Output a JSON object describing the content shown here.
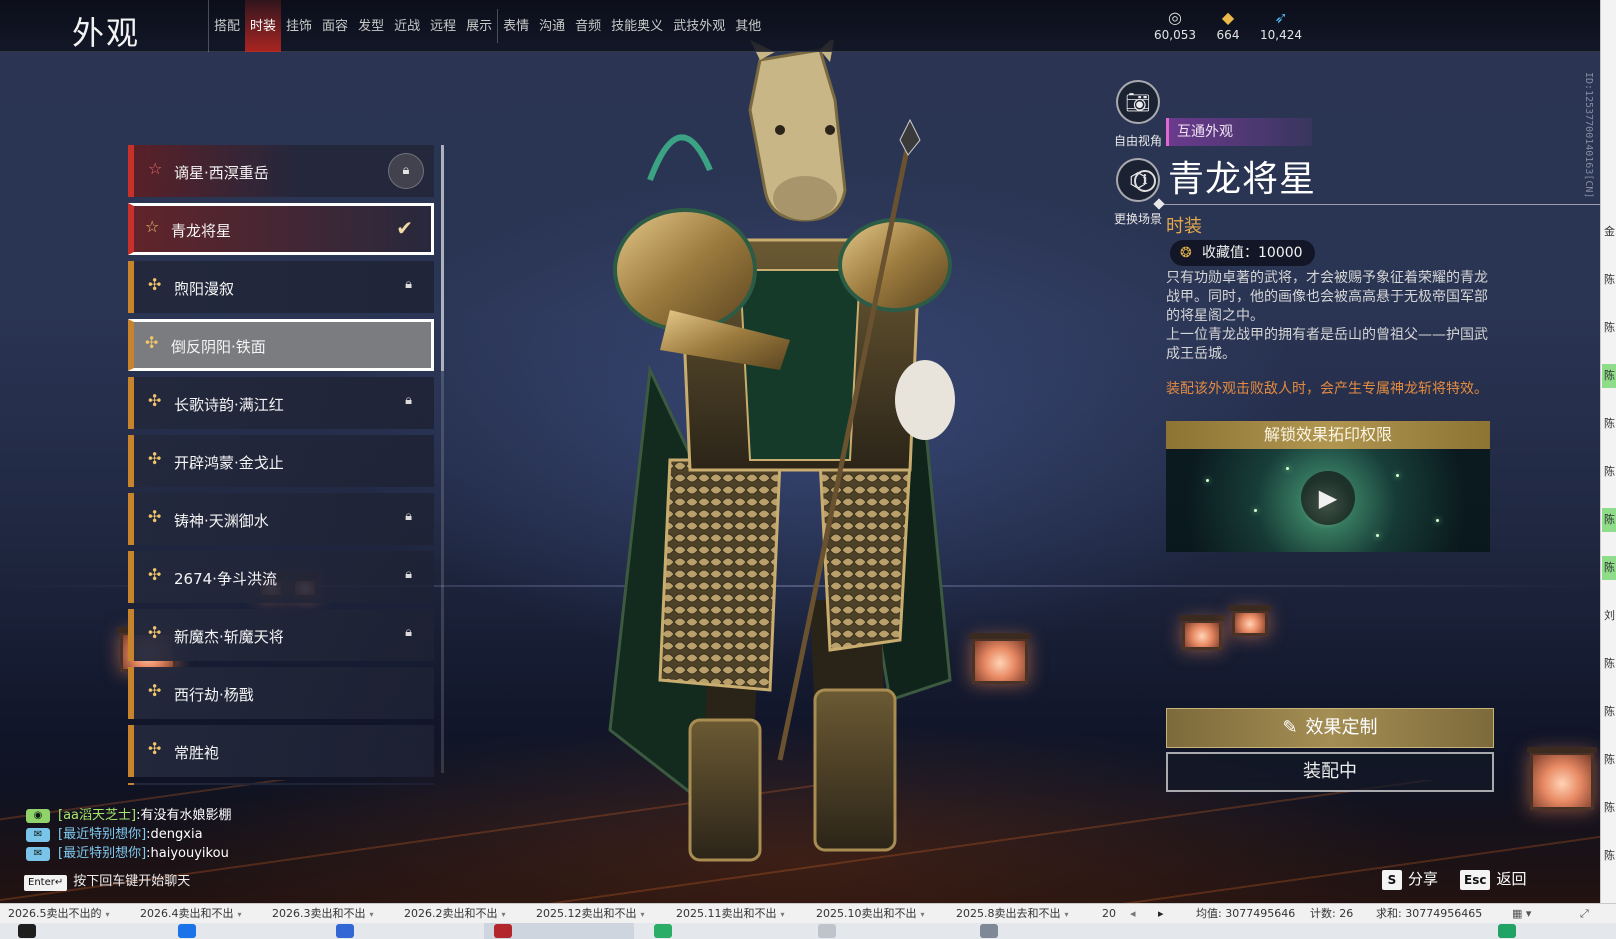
{
  "header": {
    "title": "外观",
    "tabs": [
      {
        "label": "搭配"
      },
      {
        "label": "时装"
      },
      {
        "label": "挂饰"
      },
      {
        "label": "面容"
      },
      {
        "label": "发型"
      },
      {
        "label": "近战"
      },
      {
        "label": "远程"
      },
      {
        "label": "展示"
      },
      {
        "label": "表情"
      },
      {
        "label": "沟通"
      },
      {
        "label": "音频"
      },
      {
        "label": "技能奥义"
      },
      {
        "label": "武技外观"
      },
      {
        "label": "其他"
      }
    ],
    "active_tab": "时装",
    "currencies": [
      {
        "icon": "jade-coin-icon",
        "value": "60,053"
      },
      {
        "icon": "gold-ingot-icon",
        "value": "664"
      },
      {
        "icon": "feather-token-icon",
        "value": "10,424"
      }
    ],
    "player_id": "ID:12537700140163[CN]"
  },
  "outfits": [
    {
      "name": "谪星·西溟重岳",
      "rarity": "red",
      "locked": true,
      "state": "normal"
    },
    {
      "name": "青龙将星",
      "rarity": "red",
      "locked": false,
      "state": "selected"
    },
    {
      "name": "煦阳漫叙",
      "rarity": "gold",
      "locked": true,
      "state": "normal"
    },
    {
      "name": "倒反阴阳·铁面",
      "rarity": "gold",
      "locked": false,
      "state": "hover"
    },
    {
      "name": "长歌诗韵·满江红",
      "rarity": "gold",
      "locked": true,
      "state": "normal"
    },
    {
      "name": "开辟鸿蒙·金戈止",
      "rarity": "gold",
      "locked": false,
      "state": "normal"
    },
    {
      "name": "铸神·天渊御水",
      "rarity": "gold",
      "locked": true,
      "state": "normal"
    },
    {
      "name": "2674·争斗洪流",
      "rarity": "gold",
      "locked": true,
      "state": "normal"
    },
    {
      "name": "新魔杰·斩魔天将",
      "rarity": "gold",
      "locked": true,
      "state": "normal"
    },
    {
      "name": "西行劫·杨戬",
      "rarity": "gold",
      "locked": false,
      "state": "normal"
    },
    {
      "name": "常胜袍",
      "rarity": "gold",
      "locked": false,
      "state": "normal"
    }
  ],
  "camera": {
    "free_view": "自由视角",
    "change_scene": "更换场景"
  },
  "detail": {
    "tag": "互通外观",
    "title": "青龙将星",
    "category": "时装",
    "collect_value": "收藏值：10000",
    "description": [
      "只有功勋卓著的武将，才会被赐予象征着荣耀的青龙战甲。同时，他的画像也会被高高悬于无极帝国军部的将星阁之中。",
      "上一位青龙战甲的拥有者是岳山的曾祖父——护国武成王岳城。"
    ],
    "effect_note": "装配该外观击败敌人时，会产生专属神龙斩将特效。",
    "unlock_header": "解锁效果拓印权限",
    "customize_button": "效果定制",
    "equipped_button": "装配中"
  },
  "chat": {
    "lines": [
      {
        "channel": "[aa滔天芝士]",
        "text": ":有没有水娘影棚",
        "color": "green"
      },
      {
        "channel": "[最近特别想你]",
        "text": ":dengxia",
        "color": "blue"
      },
      {
        "channel": "[最近特别想你]",
        "text": ":haiyouyikou",
        "color": "blue"
      }
    ],
    "enter_key": "Enter↵",
    "enter_hint": "按下回车键开始聊天"
  },
  "footer_keys": {
    "share_key": "S",
    "share_label": "分享",
    "back_key": "Esc",
    "back_label": "返回"
  },
  "spreadsheet": {
    "sheet_tabs": [
      "2026.5卖出不出的",
      "2026.4卖出和不出",
      "2026.3卖出和不出",
      "2026.2卖出和不出",
      "2025.12卖出和不出",
      "2025.11卖出和不出",
      "2025.10卖出和不出",
      "2025.8卖出去和不出",
      "20"
    ],
    "avg": "均值: 3077495646",
    "count": "计数: 26",
    "sum": "求和: 30774956465",
    "right_column": [
      {
        "text": "",
        "green": false
      },
      {
        "text": "",
        "green": false
      },
      {
        "text": "",
        "green": false
      },
      {
        "text": "",
        "green": false
      },
      {
        "text": "",
        "green": false
      },
      {
        "text": "",
        "green": false
      },
      {
        "text": "",
        "green": false
      },
      {
        "text": "",
        "green": false
      },
      {
        "text": "",
        "green": false
      },
      {
        "text": "金",
        "green": false
      },
      {
        "text": "",
        "green": false
      },
      {
        "text": "陈",
        "green": false
      },
      {
        "text": "",
        "green": false
      },
      {
        "text": "陈",
        "green": false
      },
      {
        "text": "",
        "green": false
      },
      {
        "text": "陈",
        "green": true
      },
      {
        "text": "",
        "green": false
      },
      {
        "text": "陈",
        "green": false
      },
      {
        "text": "",
        "green": false
      },
      {
        "text": "陈",
        "green": false
      },
      {
        "text": "",
        "green": false
      },
      {
        "text": "陈",
        "green": true
      },
      {
        "text": "",
        "green": false
      },
      {
        "text": "陈",
        "green": true
      },
      {
        "text": "",
        "green": false
      },
      {
        "text": "刘",
        "green": false
      },
      {
        "text": "",
        "green": false
      },
      {
        "text": "陈",
        "green": false
      },
      {
        "text": "",
        "green": false
      },
      {
        "text": "陈",
        "green": false
      },
      {
        "text": "",
        "green": false
      },
      {
        "text": "陈",
        "green": false
      },
      {
        "text": "",
        "green": false
      },
      {
        "text": "陈",
        "green": false
      },
      {
        "text": "",
        "green": false
      },
      {
        "text": "陈",
        "green": false
      }
    ]
  }
}
